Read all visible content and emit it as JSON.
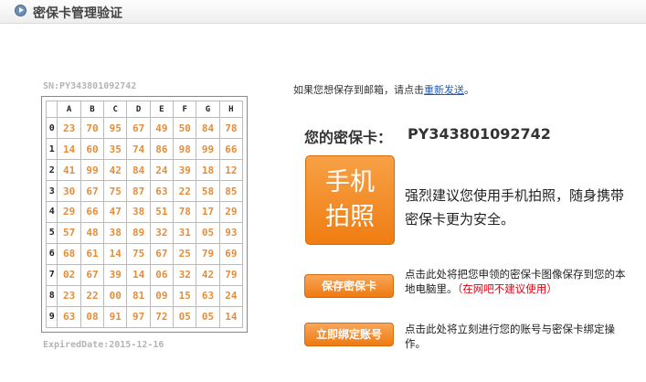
{
  "header": {
    "title": "密保卡管理验证"
  },
  "card": {
    "sn_label": "SN:PY343801092742",
    "expired_label": "ExpiredDate:2015-12-16",
    "columns": [
      "A",
      "B",
      "C",
      "D",
      "E",
      "F",
      "G",
      "H"
    ],
    "rows": [
      {
        "index": "0",
        "values": [
          "23",
          "70",
          "95",
          "67",
          "49",
          "50",
          "84",
          "78"
        ]
      },
      {
        "index": "1",
        "values": [
          "14",
          "60",
          "35",
          "74",
          "86",
          "98",
          "99",
          "66"
        ]
      },
      {
        "index": "2",
        "values": [
          "41",
          "99",
          "42",
          "84",
          "24",
          "39",
          "18",
          "12"
        ]
      },
      {
        "index": "3",
        "values": [
          "30",
          "67",
          "75",
          "87",
          "63",
          "22",
          "58",
          "85"
        ]
      },
      {
        "index": "4",
        "values": [
          "29",
          "66",
          "47",
          "38",
          "51",
          "78",
          "17",
          "29"
        ]
      },
      {
        "index": "5",
        "values": [
          "57",
          "48",
          "38",
          "89",
          "32",
          "31",
          "05",
          "93"
        ]
      },
      {
        "index": "6",
        "values": [
          "68",
          "61",
          "14",
          "75",
          "67",
          "25",
          "79",
          "69"
        ]
      },
      {
        "index": "7",
        "values": [
          "02",
          "67",
          "39",
          "14",
          "06",
          "32",
          "42",
          "79"
        ]
      },
      {
        "index": "8",
        "values": [
          "23",
          "22",
          "00",
          "81",
          "09",
          "15",
          "63",
          "24"
        ]
      },
      {
        "index": "9",
        "values": [
          "63",
          "08",
          "91",
          "97",
          "72",
          "05",
          "05",
          "14"
        ]
      }
    ]
  },
  "email": {
    "prefix": "如果您想保存到邮箱，请点击",
    "link": "重新发送",
    "suffix": "。"
  },
  "info": {
    "card_label": "您的密保卡：",
    "card_number": "PY343801092742",
    "photo_line1": "手机",
    "photo_line2": "拍照",
    "advice": "强烈建议您使用手机拍照，随身携带密保卡更为安全。"
  },
  "actions": {
    "save_label": "保存密保卡",
    "save_desc": "点击此处将把您申领的密保卡图像保存到您的本地电脑里。",
    "save_warning": "（在网吧不建议使用）",
    "bind_label": "立即绑定账号",
    "bind_desc": "点击此处将立刻进行您的账号与密保卡绑定操作。"
  }
}
